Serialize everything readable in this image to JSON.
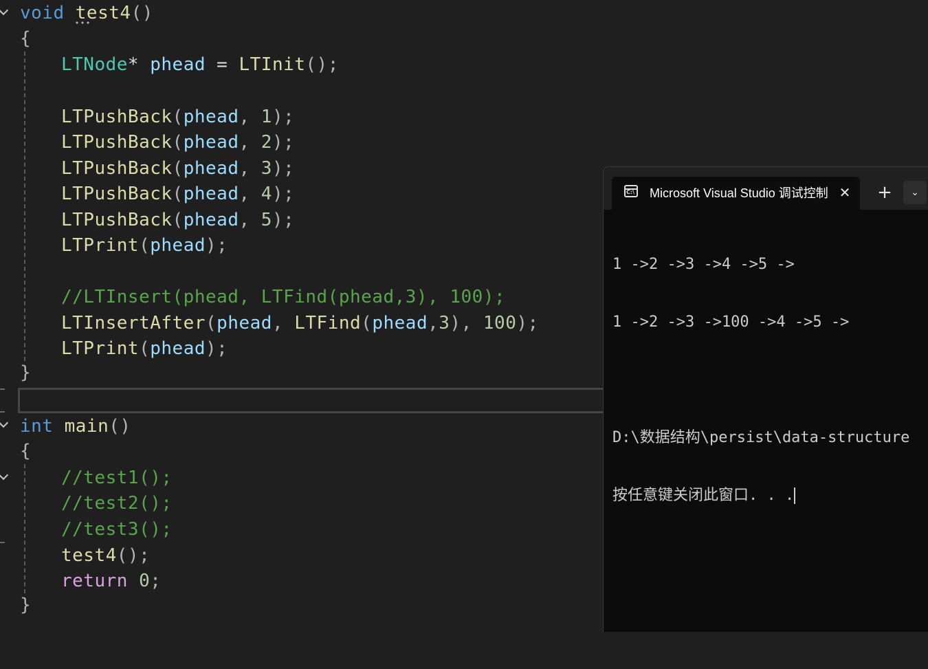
{
  "editor": {
    "lines": {
      "l1": {
        "kw": "void",
        "fn": "test4",
        "punc": "()"
      },
      "l2": {
        "brace": "{"
      },
      "l3": {
        "type": "LTNode",
        "op": "*",
        "var": "phead",
        "eq": " = ",
        "fn": "LTInit",
        "punc": "();"
      },
      "l4": {
        "fn": "LTPushBack",
        "open": "(",
        "var": "phead",
        "comma": ", ",
        "num": "1",
        "close": ");"
      },
      "l5": {
        "fn": "LTPushBack",
        "open": "(",
        "var": "phead",
        "comma": ", ",
        "num": "2",
        "close": ");"
      },
      "l6": {
        "fn": "LTPushBack",
        "open": "(",
        "var": "phead",
        "comma": ", ",
        "num": "3",
        "close": ");"
      },
      "l7": {
        "fn": "LTPushBack",
        "open": "(",
        "var": "phead",
        "comma": ", ",
        "num": "4",
        "close": ");"
      },
      "l8": {
        "fn": "LTPushBack",
        "open": "(",
        "var": "phead",
        "comma": ", ",
        "num": "5",
        "close": ");"
      },
      "l9": {
        "fn": "LTPrint",
        "open": "(",
        "var": "phead",
        "close": ");"
      },
      "l10": {
        "comment": "//LTInsert(phead, LTFind(phead,3), 100);"
      },
      "l11": {
        "fn": "LTInsertAfter",
        "open": "(",
        "var": "phead",
        "comma": ", ",
        "fn2": "LTFind",
        "open2": "(",
        "var2": "phead",
        "comma2": ",",
        "num": "3",
        "close2": "), ",
        "num2": "100",
        "close": ");"
      },
      "l12": {
        "fn": "LTPrint",
        "open": "(",
        "var": "phead",
        "close": ");"
      },
      "l13": {
        "brace": "}"
      },
      "l14": {
        "kw": "int",
        "fn": "main",
        "punc": "()"
      },
      "l15": {
        "brace": "{"
      },
      "l16": {
        "comment": "//test1();"
      },
      "l17": {
        "comment": "//test2();"
      },
      "l18": {
        "comment": "//test3();"
      },
      "l19": {
        "fn": "test4",
        "punc": "();"
      },
      "l20": {
        "kw": "return",
        "num": "0",
        "punc": ";"
      },
      "l21": {
        "brace": "}"
      }
    }
  },
  "terminal": {
    "tab_title": "Microsoft Visual Studio 调试控制台",
    "tab_icon_text": "C:\\",
    "close_glyph": "✕",
    "new_tab_glyph": "+",
    "dropdown_glyph": "⌄",
    "output": {
      "line1": "1 ->2 ->3 ->4 ->5 ->",
      "line2": "1 ->2 ->3 ->100 ->4 ->5 ->",
      "line3": "",
      "line4": "D:\\数据结构\\persist\\data-structure",
      "line5": "按任意键关闭此窗口. . ."
    }
  }
}
